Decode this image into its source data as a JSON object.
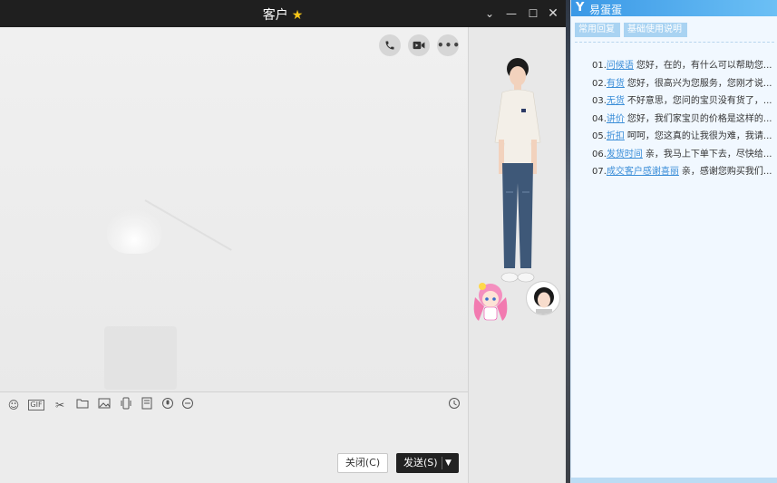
{
  "window": {
    "title": "客户",
    "star_icon": "star-icon",
    "controls": [
      "dropdown",
      "minimize",
      "maximize",
      "close"
    ]
  },
  "chat_actions": {
    "phone": "phone-icon",
    "video": "video-icon",
    "more": "•••"
  },
  "toolbar": {
    "gif_label": "GIF",
    "icons": [
      "emoji-icon",
      "gif-icon",
      "scissors-icon",
      "folder-icon",
      "image-icon",
      "vibrate-icon",
      "bookmark-icon",
      "voice-icon",
      "more-icon",
      "clock-icon"
    ]
  },
  "buttons": {
    "close_label": "关闭(C)",
    "send_label": "发送(S)"
  },
  "quick_reply": {
    "app_name": "易蛋蛋",
    "tabs": [
      "常用回复",
      "基础使用说明"
    ],
    "items": [
      {
        "num": "01.",
        "key": "问候语",
        "text": "您好，在的，有什么可以帮助您..."
      },
      {
        "num": "02.",
        "key": "有货",
        "text": "您好，很高兴为您服务，您刚才说..."
      },
      {
        "num": "03.",
        "key": "无货",
        "text": "不好意思，您问的宝贝没有货了，..."
      },
      {
        "num": "04.",
        "key": "讲价",
        "text": "您好，我们家宝贝的价格是这样的..."
      },
      {
        "num": "05.",
        "key": "折扣",
        "text": "呵呵，您这真的让我很为难，我请..."
      },
      {
        "num": "06.",
        "key": "发货时间",
        "text": "亲，我马上下单下去，尽快给..."
      },
      {
        "num": "07.",
        "key": "成交客户感谢喜丽",
        "text": "亲，感谢您购买我们..."
      }
    ]
  },
  "colors": {
    "titlebar": "#1f1f1f",
    "accent": "#3b8ed8",
    "star": "#f5c518"
  }
}
